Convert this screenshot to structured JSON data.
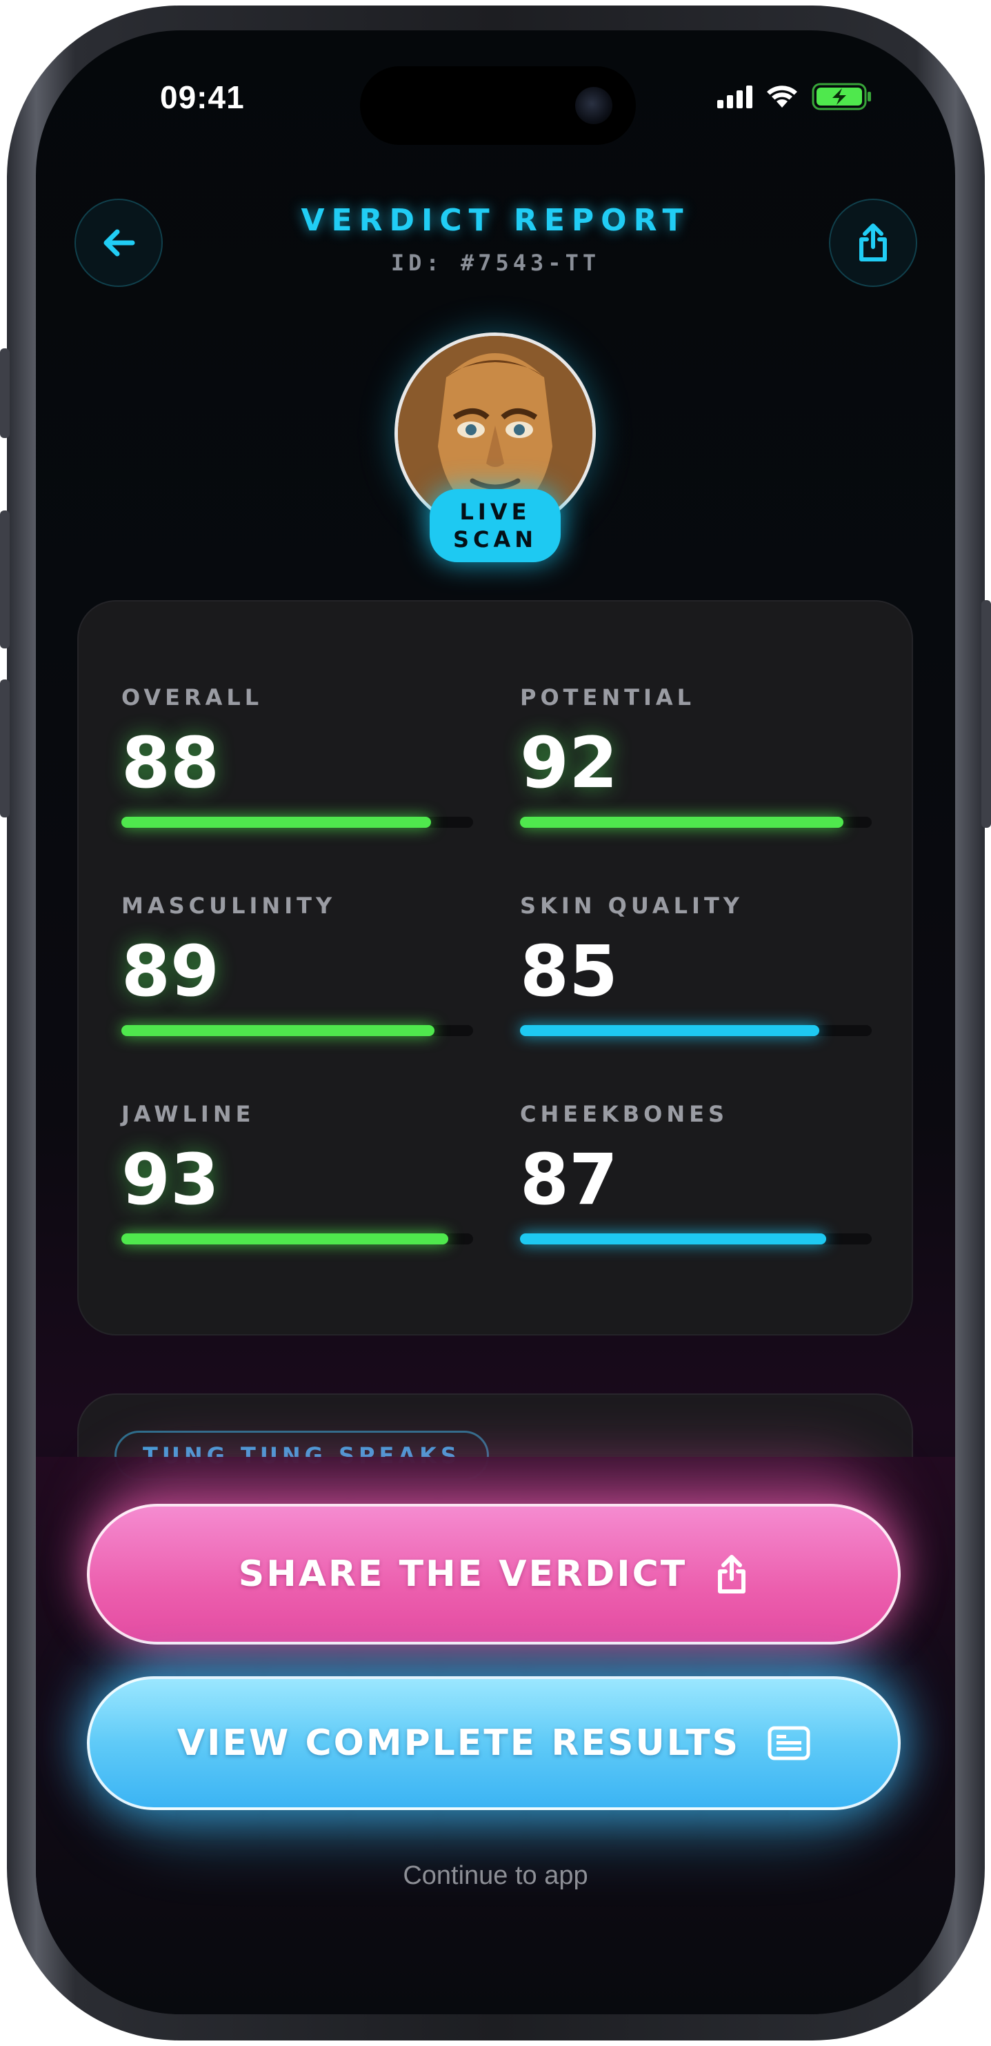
{
  "status_bar": {
    "time": "09:41"
  },
  "header": {
    "title": "VERDICT REPORT",
    "id_label": "ID: #7543-TT"
  },
  "avatar": {
    "badge_line1": "LIVE",
    "badge_line2": "SCAN"
  },
  "stats": [
    {
      "label": "OVERALL",
      "value": "88",
      "progress": 88,
      "color": "green"
    },
    {
      "label": "POTENTIAL",
      "value": "92",
      "progress": 92,
      "color": "green"
    },
    {
      "label": "MASCULINITY",
      "value": "89",
      "progress": 89,
      "color": "green"
    },
    {
      "label": "SKIN QUALITY",
      "value": "85",
      "progress": 85,
      "color": "blue"
    },
    {
      "label": "JAWLINE",
      "value": "93",
      "progress": 93,
      "color": "green"
    },
    {
      "label": "CHEEKBONES",
      "value": "87",
      "progress": 87,
      "color": "blue"
    }
  ],
  "speaks": {
    "tag": "TUNG TUNG SPEAKS"
  },
  "actions": {
    "share_label": "SHARE THE VERDICT",
    "view_label": "VIEW COMPLETE RESULTS",
    "continue_label": "Continue to app"
  },
  "colors": {
    "accent_cyan": "#21cdf5",
    "green": "#4fe84d",
    "pink": "#ec5fae",
    "blue": "#3bb4f4"
  },
  "icons": {
    "back": "arrow-left-icon",
    "share": "share-icon",
    "results": "document-list-icon"
  }
}
